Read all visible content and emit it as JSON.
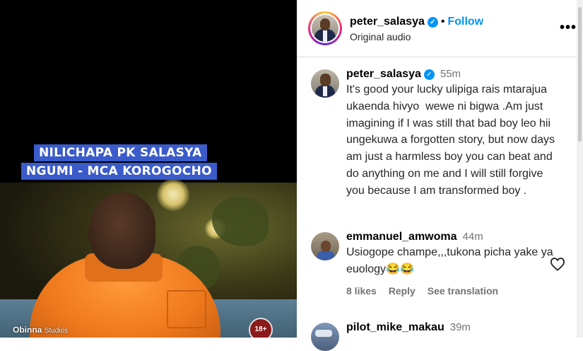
{
  "video": {
    "caption_line1": "NILICHAPA PK SALASYA",
    "caption_line2": "NGUMI - MCA KOROGOCHO",
    "watermark_brand": "Obinna",
    "watermark_studio": "Studios",
    "rating_badge": "18+"
  },
  "header": {
    "username": "peter_salasya",
    "separator": "•",
    "follow_label": "Follow",
    "audio_label": "Original audio",
    "more_icon": "more-horizontal-icon"
  },
  "comments": [
    {
      "username": "peter_salasya",
      "time": "55m",
      "text": "It's good your lucky ulipiga rais mtarajua ukaenda hivyo  wewe ni bigwa .Am just imagining if I was still that bad boy leo hii ungekuwa a forgotten story, but now days  am just a harmless boy you can beat and do anything on me and I will still forgive you because I am transformed boy ."
    },
    {
      "username": "emmanuel_amwoma",
      "time": "44m",
      "text": "Usiogope champe,,,tukona picha yake ya euology😂😂",
      "likes": "8 likes",
      "reply_label": "Reply",
      "translate_label": "See translation"
    },
    {
      "username": "pilot_mike_makau",
      "time": "39m"
    }
  ],
  "colors": {
    "accent": "#0095f6",
    "caption_bg": "#3a5bc9",
    "shirt": "#f07a1e"
  }
}
